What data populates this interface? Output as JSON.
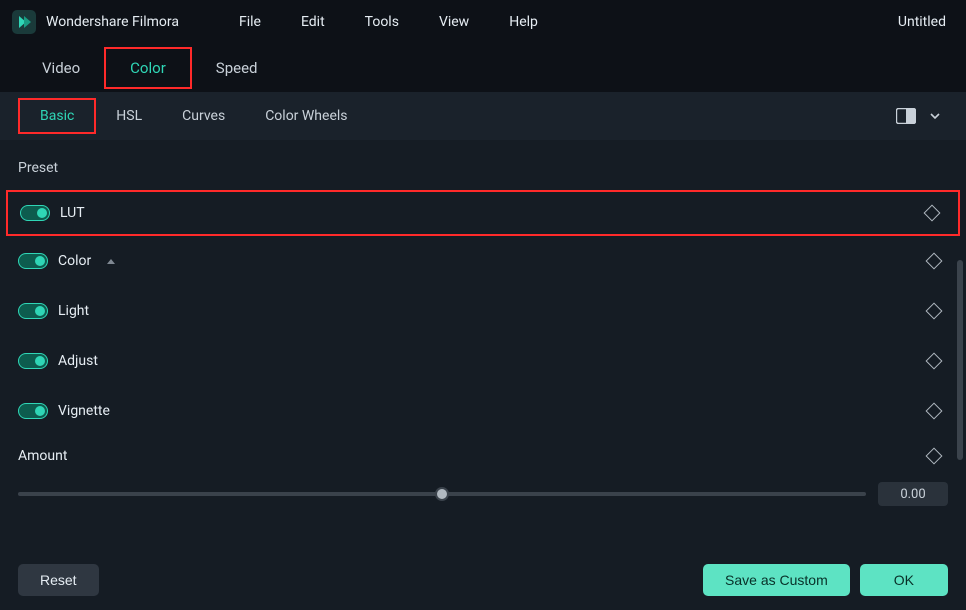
{
  "app_name": "Wondershare Filmora",
  "doc_title": "Untitled",
  "menu": {
    "file": "File",
    "edit": "Edit",
    "tools": "Tools",
    "view": "View",
    "help": "Help"
  },
  "tabs_primary": {
    "video": "Video",
    "color": "Color",
    "speed": "Speed"
  },
  "tabs_secondary": {
    "basic": "Basic",
    "hsl": "HSL",
    "curves": "Curves",
    "color_wheels": "Color Wheels"
  },
  "panel": {
    "preset_label": "Preset",
    "props": {
      "lut": "LUT",
      "color": "Color",
      "light": "Light",
      "adjust": "Adjust",
      "vignette": "Vignette"
    },
    "amount_label": "Amount",
    "amount_value": "0.00"
  },
  "footer": {
    "reset": "Reset",
    "save_custom": "Save as Custom",
    "ok": "OK"
  }
}
